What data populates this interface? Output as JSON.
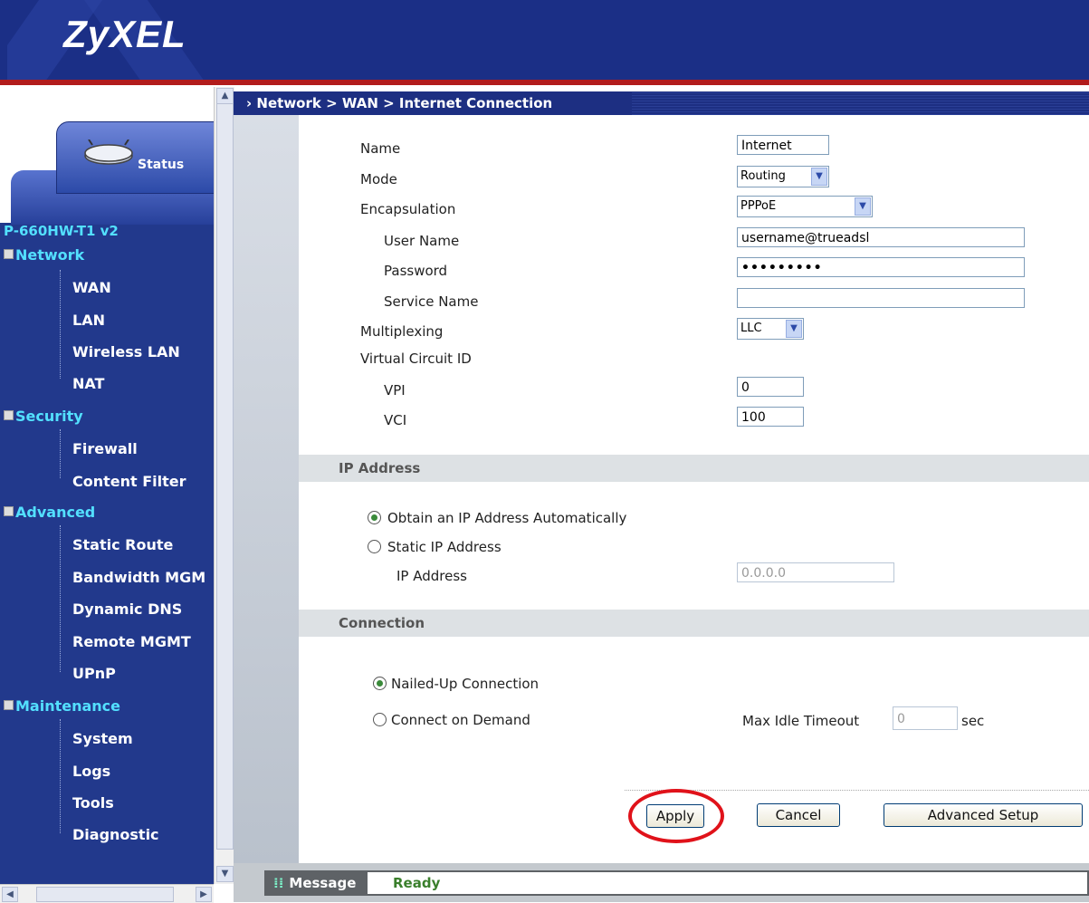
{
  "header": {
    "logo": "ZyXEL"
  },
  "sidebar": {
    "status_tab": "Status",
    "model": "P-660HW-T1 v2",
    "groups": [
      {
        "label": "Network",
        "items": [
          "WAN",
          "LAN",
          "Wireless LAN",
          "NAT"
        ]
      },
      {
        "label": "Security",
        "items": [
          "Firewall",
          "Content Filter"
        ]
      },
      {
        "label": "Advanced",
        "items": [
          "Static Route",
          "Bandwidth MGM",
          "Dynamic DNS",
          "Remote MGMT",
          "UPnP"
        ]
      },
      {
        "label": "Maintenance",
        "items": [
          "System",
          "Logs",
          "Tools",
          "Diagnostic"
        ]
      }
    ]
  },
  "breadcrumb": "Network > WAN > Internet Connection",
  "form": {
    "name_label": "Name",
    "name_value": "Internet",
    "mode_label": "Mode",
    "mode_value": "Routing",
    "encap_label": "Encapsulation",
    "encap_value": "PPPoE",
    "user_label": "User Name",
    "user_value": "username@trueadsl",
    "pass_label": "Password",
    "pass_value": "•••••••••",
    "service_label": "Service Name",
    "service_value": "",
    "mux_label": "Multiplexing",
    "mux_value": "LLC",
    "vc_label": "Virtual Circuit ID",
    "vpi_label": "VPI",
    "vpi_value": "0",
    "vci_label": "VCI",
    "vci_value": "100"
  },
  "ip_section": {
    "title": "IP Address",
    "auto_label": "Obtain an IP Address Automatically",
    "static_label": "Static IP Address",
    "ip_label": "IP Address",
    "ip_value": "0.0.0.0"
  },
  "conn_section": {
    "title": "Connection",
    "nailed_label": "Nailed-Up Connection",
    "demand_label": "Connect on Demand",
    "idle_label": "Max Idle Timeout",
    "idle_value": "0",
    "idle_unit": "sec"
  },
  "buttons": {
    "apply": "Apply",
    "cancel": "Cancel",
    "advanced": "Advanced Setup"
  },
  "statusbar": {
    "label": "Message",
    "value": "Ready"
  },
  "colors": {
    "header": "#1b2f86",
    "sidebar": "#22398c",
    "accent": "#e0121a",
    "tree_group": "#53e0ff"
  }
}
